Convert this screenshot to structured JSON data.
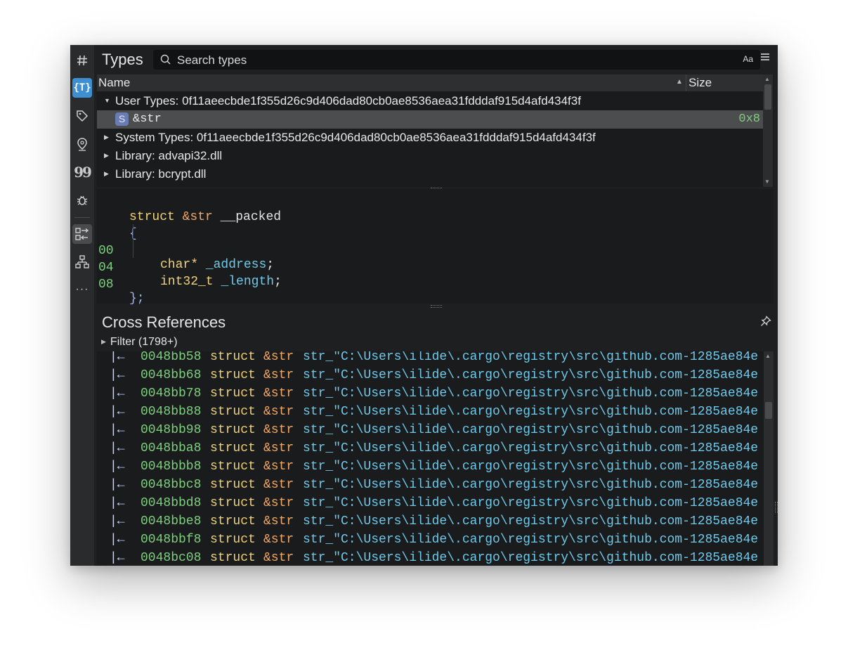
{
  "sidebar": {
    "icons": [
      {
        "name": "hash-icon",
        "active": false
      },
      {
        "name": "types-icon",
        "active": true
      },
      {
        "name": "tag-icon",
        "active": false
      },
      {
        "name": "location-pin-icon",
        "active": false
      },
      {
        "name": "quote-icon",
        "active": false
      },
      {
        "name": "bug-icon",
        "active": false
      },
      {
        "name": "cross-references-icon",
        "active": false
      },
      {
        "name": "hierarchy-icon",
        "active": false
      },
      {
        "name": "more-icon",
        "active": false
      }
    ]
  },
  "types_panel": {
    "title": "Types",
    "search_placeholder": "Search types",
    "case_toggle": "Aa",
    "columns": {
      "name": "Name",
      "size": "Size"
    },
    "rows": [
      {
        "label": "User Types: 0f11aeecbde1f355d26c9d406dad80cb0ae8536aea31fdddaf915d4afd434f3f",
        "expanded": true
      },
      {
        "badge": "S",
        "label": "&str",
        "size": "0x8",
        "selected": true
      },
      {
        "label": "System Types: 0f11aeecbde1f355d26c9d406dad80cb0ae8536aea31fdddaf915d4afd434f3f",
        "expanded": false
      },
      {
        "label": "Library: advapi32.dll",
        "expanded": false
      },
      {
        "label": "Library: bcrypt.dll",
        "expanded": false
      }
    ]
  },
  "struct_view": {
    "keyword": "struct",
    "type_name": "&str",
    "qualifier": "__packed",
    "open_brace": "{",
    "close_brace": "};",
    "fields": [
      {
        "offset": "00",
        "type": "char*",
        "name": "_address"
      },
      {
        "offset": "04",
        "type": "int32_t",
        "name": "_length"
      }
    ],
    "end_offset": "08",
    "semicolon": ";"
  },
  "cross_references": {
    "title": "Cross References",
    "filter_label": "Filter (1798+)",
    "rows": [
      {
        "arrow": "|←",
        "address": "0048bb58",
        "keyword": "struct",
        "type": "&str",
        "symbol": "str_\"C:\\Users\\ilide\\.cargo\\registry\\src\\github.com-1285ae84e"
      },
      {
        "arrow": "|←",
        "address": "0048bb68",
        "keyword": "struct",
        "type": "&str",
        "symbol": "str_\"C:\\Users\\ilide\\.cargo\\registry\\src\\github.com-1285ae84e"
      },
      {
        "arrow": "|←",
        "address": "0048bb78",
        "keyword": "struct",
        "type": "&str",
        "symbol": "str_\"C:\\Users\\ilide\\.cargo\\registry\\src\\github.com-1285ae84e"
      },
      {
        "arrow": "|←",
        "address": "0048bb88",
        "keyword": "struct",
        "type": "&str",
        "symbol": "str_\"C:\\Users\\ilide\\.cargo\\registry\\src\\github.com-1285ae84e"
      },
      {
        "arrow": "|←",
        "address": "0048bb98",
        "keyword": "struct",
        "type": "&str",
        "symbol": "str_\"C:\\Users\\ilide\\.cargo\\registry\\src\\github.com-1285ae84e"
      },
      {
        "arrow": "|←",
        "address": "0048bba8",
        "keyword": "struct",
        "type": "&str",
        "symbol": "str_\"C:\\Users\\ilide\\.cargo\\registry\\src\\github.com-1285ae84e"
      },
      {
        "arrow": "|←",
        "address": "0048bbb8",
        "keyword": "struct",
        "type": "&str",
        "symbol": "str_\"C:\\Users\\ilide\\.cargo\\registry\\src\\github.com-1285ae84e"
      },
      {
        "arrow": "|←",
        "address": "0048bbc8",
        "keyword": "struct",
        "type": "&str",
        "symbol": "str_\"C:\\Users\\ilide\\.cargo\\registry\\src\\github.com-1285ae84e"
      },
      {
        "arrow": "|←",
        "address": "0048bbd8",
        "keyword": "struct",
        "type": "&str",
        "symbol": "str_\"C:\\Users\\ilide\\.cargo\\registry\\src\\github.com-1285ae84e"
      },
      {
        "arrow": "|←",
        "address": "0048bbe8",
        "keyword": "struct",
        "type": "&str",
        "symbol": "str_\"C:\\Users\\ilide\\.cargo\\registry\\src\\github.com-1285ae84e"
      },
      {
        "arrow": "|←",
        "address": "0048bbf8",
        "keyword": "struct",
        "type": "&str",
        "symbol": "str_\"C:\\Users\\ilide\\.cargo\\registry\\src\\github.com-1285ae84e"
      },
      {
        "arrow": "|←",
        "address": "0048bc08",
        "keyword": "struct",
        "type": "&str",
        "symbol": "str_\"C:\\Users\\ilide\\.cargo\\registry\\src\\github.com-1285ae84e"
      }
    ]
  },
  "colors": {
    "accent": "#3d8fd1",
    "address": "#7ed07e",
    "keyword": "#efd27a",
    "type": "#f0a868",
    "field": "#6fc9ea"
  }
}
